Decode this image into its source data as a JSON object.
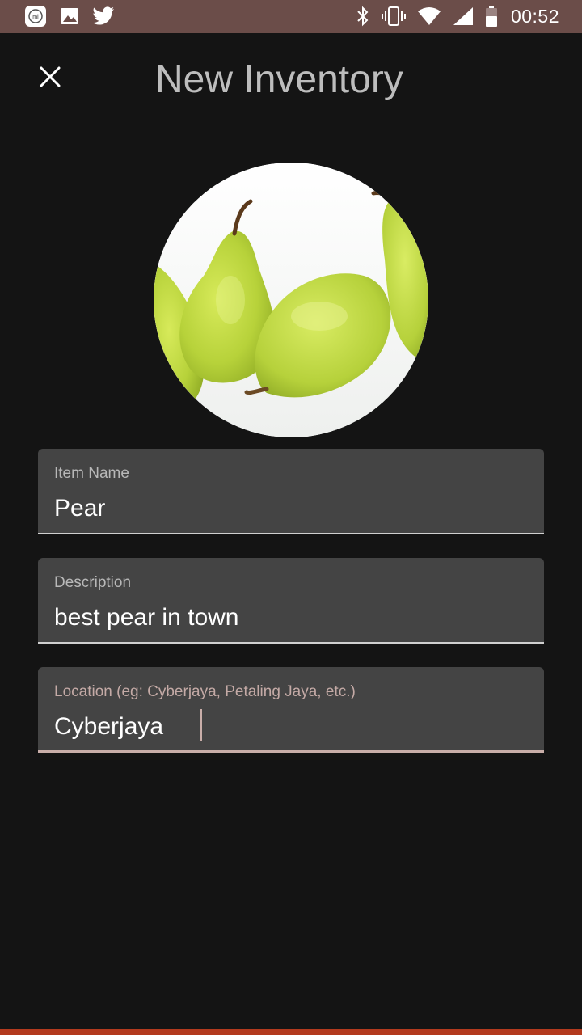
{
  "status_bar": {
    "time": "00:52",
    "background": "#6b4d49",
    "left_icons": [
      "mi-icon",
      "gallery-icon",
      "twitter-icon"
    ],
    "right_icons": [
      "bluetooth-icon",
      "vibrate-icon",
      "wifi-icon",
      "signal-icon",
      "battery-icon"
    ]
  },
  "app_bar": {
    "title": "New Inventory",
    "close_icon": "close-icon"
  },
  "photo": {
    "subject": "pears"
  },
  "form": {
    "item_name": {
      "label": "Item Name",
      "value": "Pear"
    },
    "description": {
      "label": "Description",
      "value": "best pear in town"
    },
    "location": {
      "label": "Location (eg: Cyberjaya, Petaling Jaya, etc.)",
      "value": "Cyberjaya"
    }
  },
  "colors": {
    "background": "#141414",
    "field_background": "#444444",
    "accent": "#c9aea9",
    "title": "#bdbdbd",
    "nav_bar": "#b33a1e"
  }
}
